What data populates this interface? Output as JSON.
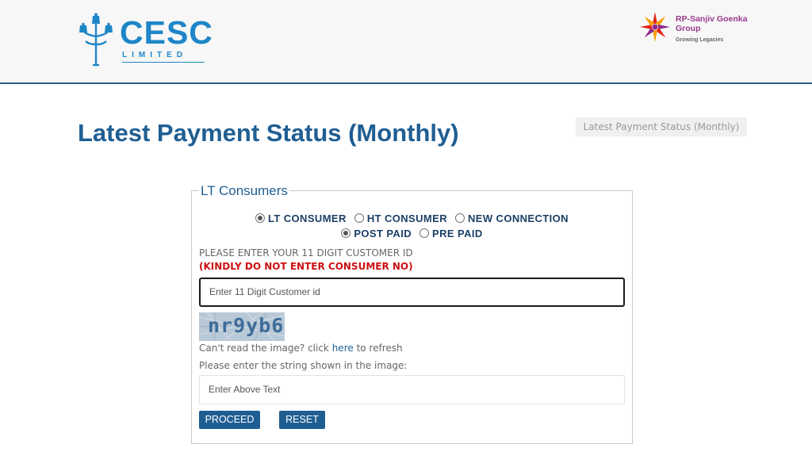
{
  "header": {
    "cesc_logo": {
      "name": "CESC",
      "subtitle": "LIMITED",
      "icon": "street-lamp-icon"
    },
    "group_logo": {
      "name": "RP-Sanjiv Goenka Group",
      "tagline": "Growing Legacies",
      "icon": "rpsg-star-icon"
    }
  },
  "page": {
    "title": "Latest Payment Status (Monthly)",
    "breadcrumb": "Latest Payment Status (Monthly)"
  },
  "form": {
    "legend": "LT Consumers",
    "consumer_types": [
      {
        "label": "LT CONSUMER",
        "checked": true
      },
      {
        "label": "HT CONSUMER",
        "checked": false
      },
      {
        "label": "NEW CONNECTION",
        "checked": false
      }
    ],
    "payment_types": [
      {
        "label": "POST PAID",
        "checked": true
      },
      {
        "label": "PRE PAID",
        "checked": false
      }
    ],
    "instruction": "PLEASE ENTER YOUR 11 DIGIT CUSTOMER ID",
    "warning": "(KINDLY DO NOT ENTER CONSUMER NO)",
    "customer_id": {
      "value": "",
      "placeholder": "Enter 11 Digit Customer id"
    },
    "captcha": {
      "image_text": "nr9yb6",
      "refresh_prefix": "Can't read the image? click ",
      "refresh_link": "here",
      "refresh_suffix": " to refresh",
      "prompt": "Please enter the string shown in the image:",
      "input": {
        "value": "",
        "placeholder": "Enter Above Text"
      }
    },
    "buttons": {
      "proceed": "PROCEED",
      "reset": "RESET"
    }
  },
  "colors": {
    "brand_blue": "#1f5e92",
    "warning_red": "#cc1111",
    "cesc_blue": "#1e86c8",
    "rpsg_purple": "#9a3a8e"
  }
}
